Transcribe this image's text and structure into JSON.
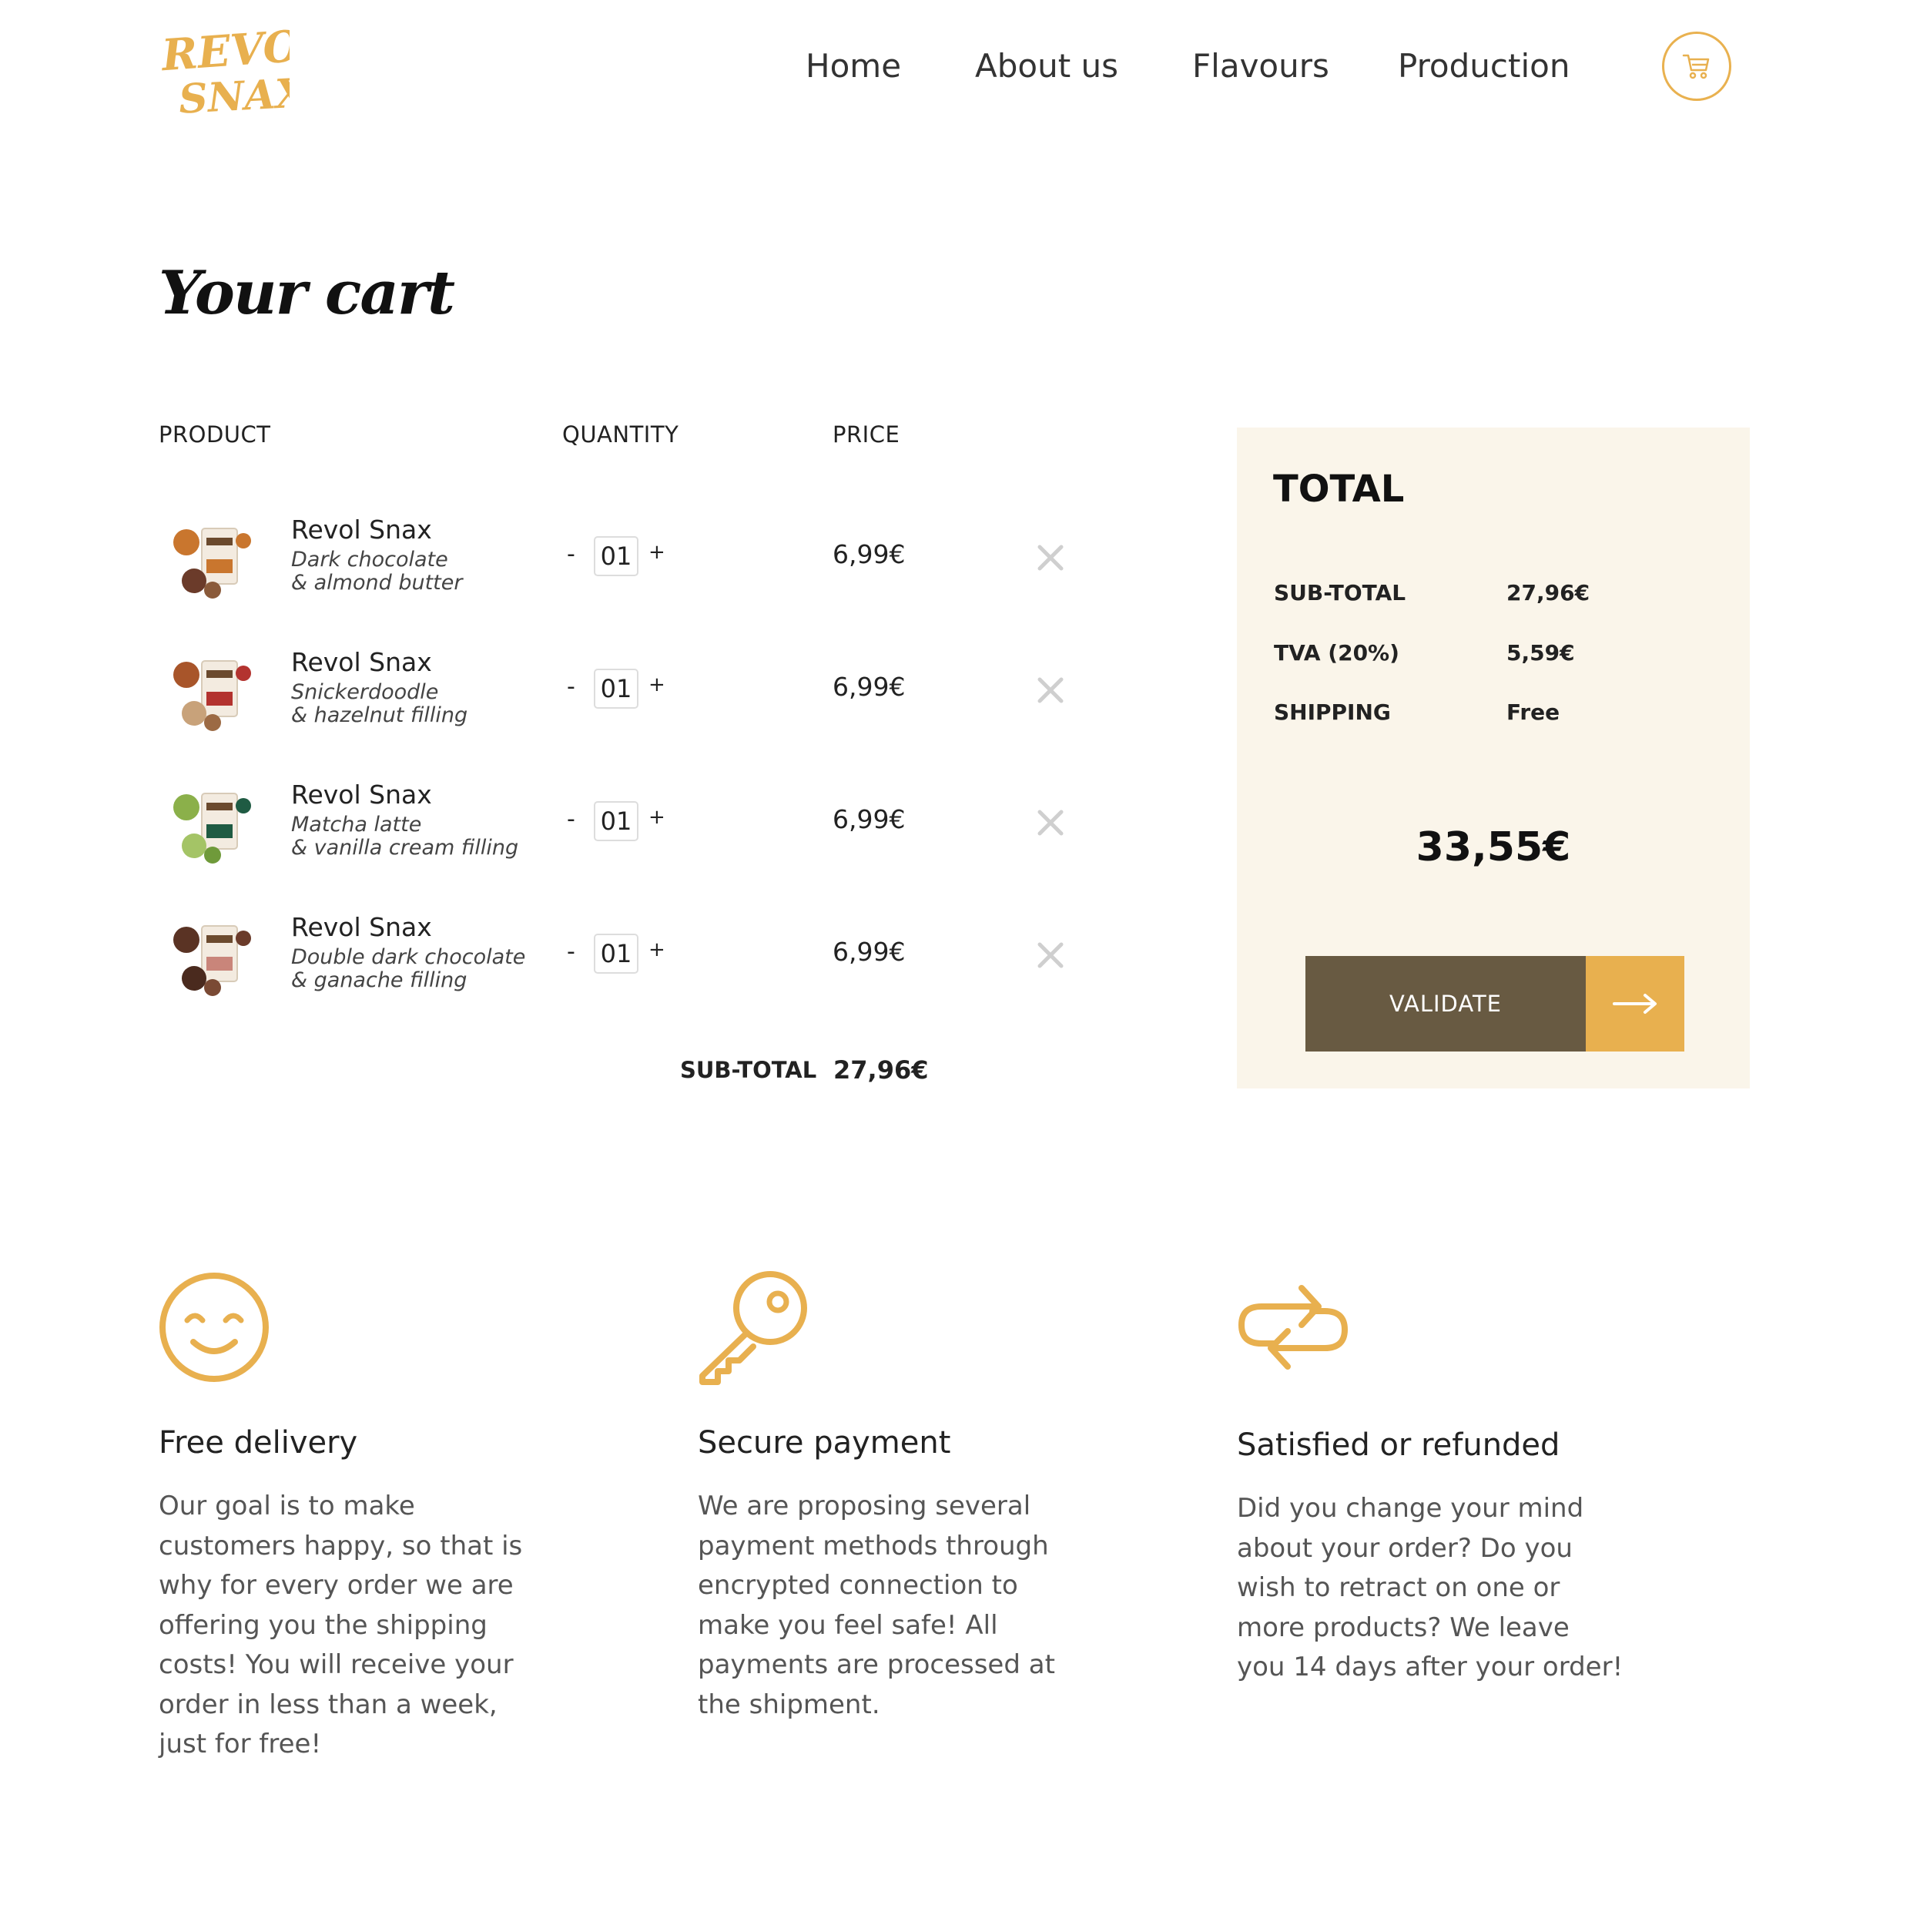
{
  "header": {
    "logo": {
      "line1": "REVOL",
      "line2": "SNAX"
    },
    "nav": [
      "Home",
      "About us",
      "Flavours",
      "Production"
    ],
    "cart_icon": "shopping-cart-icon"
  },
  "page_title": "Your cart",
  "table": {
    "headers": {
      "product": "PRODUCT",
      "quantity": "QUANTITY",
      "price": "PRICE"
    },
    "rows": [
      {
        "name": "Revol Snax",
        "desc1": "Dark chocolate",
        "desc2": "& almond butter",
        "qty": "01",
        "minus": "-",
        "plus": "+",
        "price": "6,99€",
        "accent": "#c9762e"
      },
      {
        "name": "Revol Snax",
        "desc1": "Snickerdoodle",
        "desc2": "& hazelnut filling",
        "qty": "01",
        "minus": "-",
        "plus": "+",
        "price": "6,99€",
        "accent": "#b3332f"
      },
      {
        "name": "Revol Snax",
        "desc1": "Matcha latte",
        "desc2": "& vanilla cream filling",
        "qty": "01",
        "minus": "-",
        "plus": "+",
        "price": "6,99€",
        "accent": "#1f5b43"
      },
      {
        "name": "Revol Snax",
        "desc1": "Double dark chocolate",
        "desc2": "& ganache filling",
        "qty": "01",
        "minus": "-",
        "plus": "+",
        "price": "6,99€",
        "accent": "#6b3b2a"
      }
    ],
    "subtotal_label": "SUB-TOTAL",
    "subtotal_value": "27,96€"
  },
  "summary": {
    "title": "TOTAL",
    "lines": [
      {
        "label": "SUB-TOTAL",
        "value": "27,96€"
      },
      {
        "label": "TVA (20%)",
        "value": "5,59€"
      },
      {
        "label": "SHIPPING",
        "value": "Free"
      }
    ],
    "total": "33,55€",
    "validate_label": "VALIDATE"
  },
  "features": [
    {
      "icon": "smiley-icon",
      "title": "Free delivery",
      "lines": [
        "Our goal is to make",
        "customers happy, so that is",
        "why for every order we are",
        "offering you the shipping",
        "costs! You will receive your",
        "order in less than a week,",
        "just for free!"
      ]
    },
    {
      "icon": "key-icon",
      "title": "Secure payment",
      "lines": [
        "We are proposing several",
        "payment methods through",
        "encrypted connection to",
        "make you feel safe! All",
        "payments are processed at",
        "the shipment."
      ]
    },
    {
      "icon": "refresh-arrows-icon",
      "title": "Satisfied or refunded",
      "lines": [
        "Did you change your mind",
        "about your order? Do you",
        "wish to retract on one or",
        "more products? We leave",
        "you 14 days after your order!"
      ]
    }
  ],
  "colors": {
    "accent": "#e8b04f",
    "dark_button": "#685a42",
    "panel_bg": "#faf5ea"
  }
}
